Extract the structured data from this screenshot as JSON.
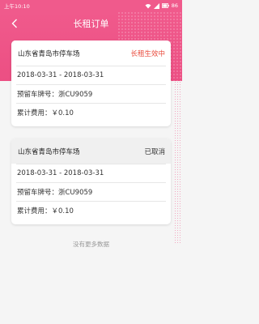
{
  "status_bar": {
    "time": "上午10:10",
    "battery": "86"
  },
  "nav": {
    "title": "长租订单"
  },
  "orders": [
    {
      "lot": "山东省青岛市停车场",
      "status": "长租生效中",
      "status_color": "#e94b3c",
      "dates": "2018-03-31 - 2018-03-31",
      "plate": "预留车牌号：浙CU9059",
      "cost": "累计费用：￥0.10"
    },
    {
      "lot": "山东省青岛市停车场",
      "status": "已取消",
      "status_color": "#333333",
      "dates": "2018-03-31 - 2018-03-31",
      "plate": "预留车牌号：浙CU9059",
      "cost": "累计费用：￥0.10"
    }
  ],
  "footer": {
    "text": "没有更多数据"
  },
  "colors": {
    "primary": "#f05a8c"
  },
  "icons": {
    "back": "chevron-left-icon",
    "wifi": "wifi-icon",
    "signal": "signal-icon",
    "battery": "battery-icon"
  }
}
